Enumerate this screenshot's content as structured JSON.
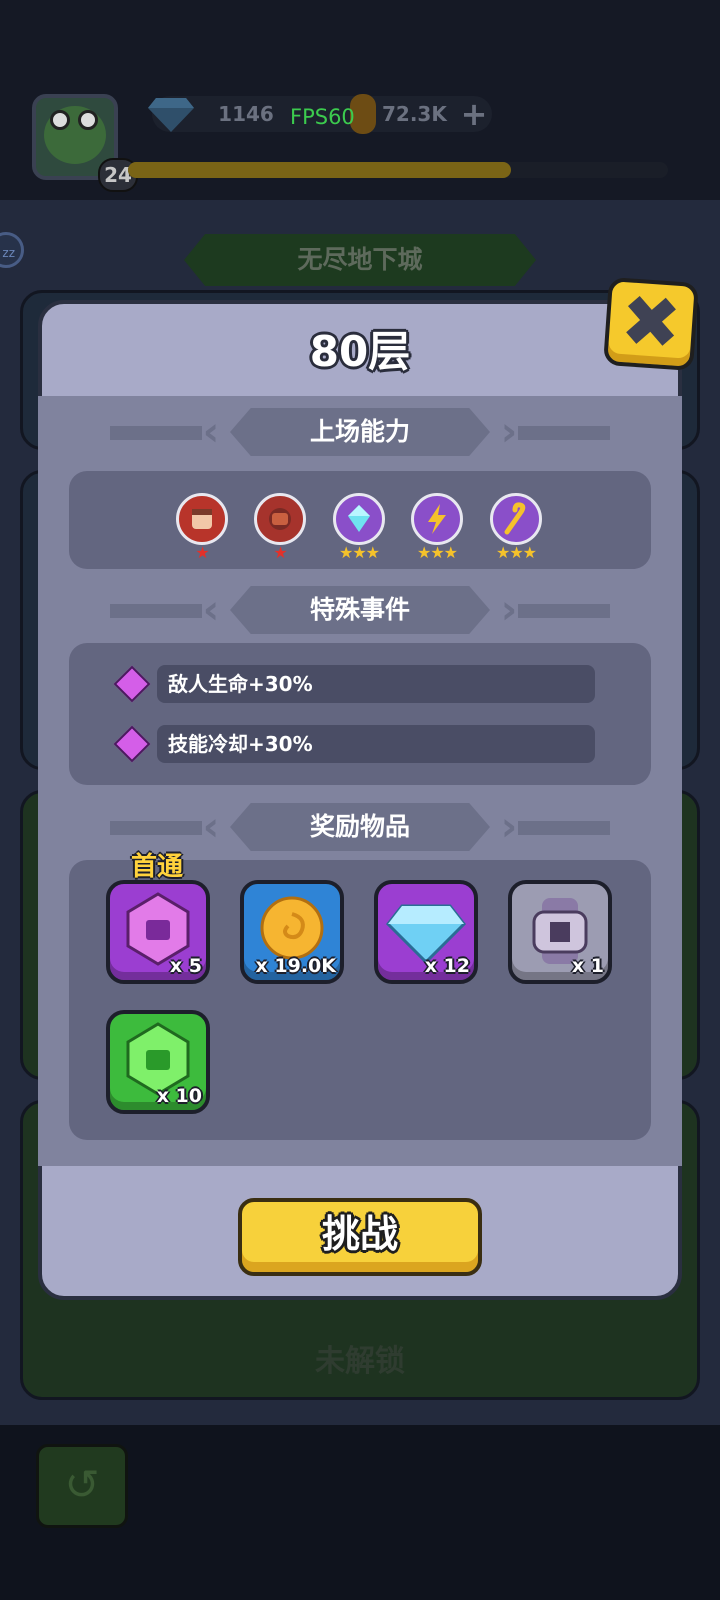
{
  "header": {
    "level": "24",
    "gems": "1146",
    "fps": "FPS60",
    "coins": "72.3K",
    "plus_label": "+",
    "side_badge": "zz",
    "xp_progress": 0.71
  },
  "background": {
    "dungeon_title": "无尽地下城",
    "locked_label": "未解锁"
  },
  "dialog": {
    "title": "80层",
    "close_label": "✖",
    "abilities_title": "上场能力",
    "abilities": [
      {
        "icon": "fist-crest-icon",
        "stars": "★",
        "color": "#b8342a"
      },
      {
        "icon": "fist-icon",
        "stars": "★",
        "color": "#a6332c"
      },
      {
        "icon": "ice-shield-icon",
        "stars": "★★★",
        "color": "#8a4fc9"
      },
      {
        "icon": "lightning-icon",
        "stars": "★★★",
        "color": "#8a4fc9"
      },
      {
        "icon": "cane-icon",
        "stars": "★★★",
        "color": "#8a4fc9"
      }
    ],
    "events_title": "特殊事件",
    "events": [
      {
        "text": "敌人生命+30%"
      },
      {
        "text": "技能冷却+30%"
      }
    ],
    "rewards_title": "奖励物品",
    "first_clear_tag": "首通",
    "rewards": [
      {
        "icon": "purple-shirt-gem-icon",
        "count": "x 5",
        "bg": "#9b3ed1"
      },
      {
        "icon": "gold-coin-icon",
        "count": "x 19.0K",
        "bg": "#2f84d6"
      },
      {
        "icon": "diamond-icon",
        "count": "x 12",
        "bg": "#9b3ed1"
      },
      {
        "icon": "watch-icon",
        "count": "x 1",
        "bg": "#9c9cb2"
      },
      {
        "icon": "green-shirt-gem-icon",
        "count": "x 10",
        "bg": "#3dbb3d"
      }
    ],
    "challenge_label": "挑战"
  },
  "colors": {
    "accent_yellow": "#f7d13b",
    "panel_gray": "#636680",
    "dialog_bg": "#a8aac8"
  }
}
